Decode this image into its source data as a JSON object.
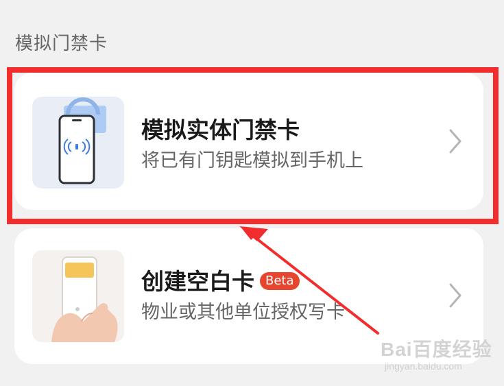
{
  "section": {
    "title": "模拟门禁卡"
  },
  "cards": [
    {
      "title": "模拟实体门禁卡",
      "subtitle": "将已有门钥匙模拟到手机上",
      "icon": "phone-nfc-icon",
      "chevron": "chevron-right-icon"
    },
    {
      "title": "创建空白卡",
      "badge": "Beta",
      "subtitle": "物业或其他单位授权写卡",
      "icon": "hand-phone-card-icon",
      "chevron": "chevron-right-icon"
    }
  ],
  "annotation": {
    "highlight_color": "#f22d2d",
    "arrow_color": "#f22d2d"
  },
  "watermark": {
    "brand": "Bai百度经验",
    "url": "jingyan.baidu.com"
  },
  "colors": {
    "background": "#f1f1f1",
    "card": "#ffffff",
    "badge": "#e8452f",
    "subtitle": "#666666"
  }
}
